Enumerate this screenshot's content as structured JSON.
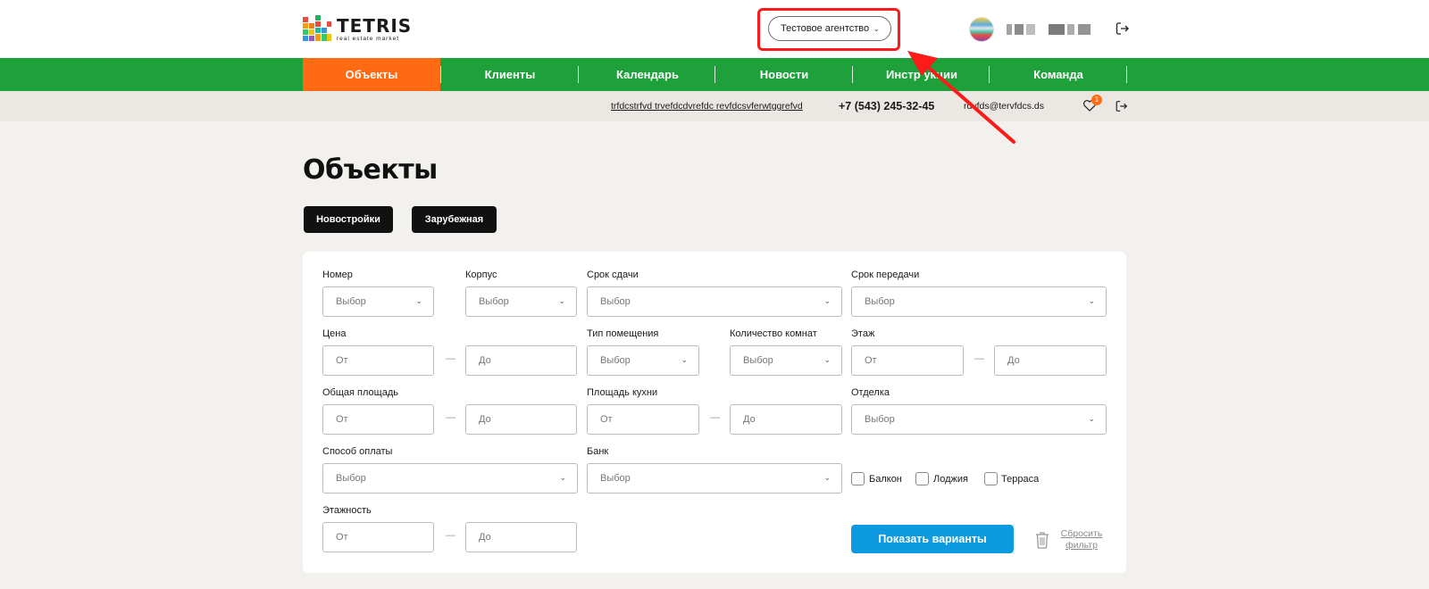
{
  "header": {
    "logo_text": "TETRIS",
    "logo_subtitle": "real estate market",
    "agency_select": "Тестовое агентство",
    "username": "",
    "colors": {
      "green": "#1ea03a",
      "orange": "#ff6a13",
      "blue": "#0e9ae0"
    }
  },
  "nav": {
    "items": [
      "Объекты",
      "Клиенты",
      "Календарь",
      "Новости",
      "Инструкции",
      "Команда"
    ],
    "visible_labels": [
      "Объекты",
      "Клиенты",
      "Календарь",
      "Новости",
      "Инстр   укции",
      "Команда"
    ],
    "active": "Объекты"
  },
  "infobar": {
    "link": "trfdcstrfvd trvefdcdvrefdc revfdcsvferwtggrefvd",
    "phone": "+7 (543) 245-32-45",
    "email": "rdvfds@tervfdcs.ds",
    "favorites_count": "1"
  },
  "page": {
    "title": "Объекты",
    "tabs": [
      "Новостройки",
      "Зарубежная"
    ]
  },
  "filters": {
    "placeholder_select": "Выбор",
    "placeholder_from": "От",
    "placeholder_to": "До",
    "dash": "—",
    "labels": {
      "number": "Номер",
      "building": "Корпус",
      "deadline": "Срок сдачи",
      "handover": "Срок передачи",
      "price": "Цена",
      "room_type": "Тип помещения",
      "rooms": "Количество комнат",
      "floor": "Этаж",
      "total_area": "Общая площадь",
      "kitchen_area": "Площадь кухни",
      "finish": "Отделка",
      "payment": "Способ оплаты",
      "bank": "Банк",
      "storeys": "Этажность"
    },
    "checkboxes": [
      "Балкон",
      "Лоджия",
      "Терраса"
    ],
    "submit": "Показать варианты",
    "reset_line1": "Сбросить",
    "reset_line2": "фильтр"
  }
}
